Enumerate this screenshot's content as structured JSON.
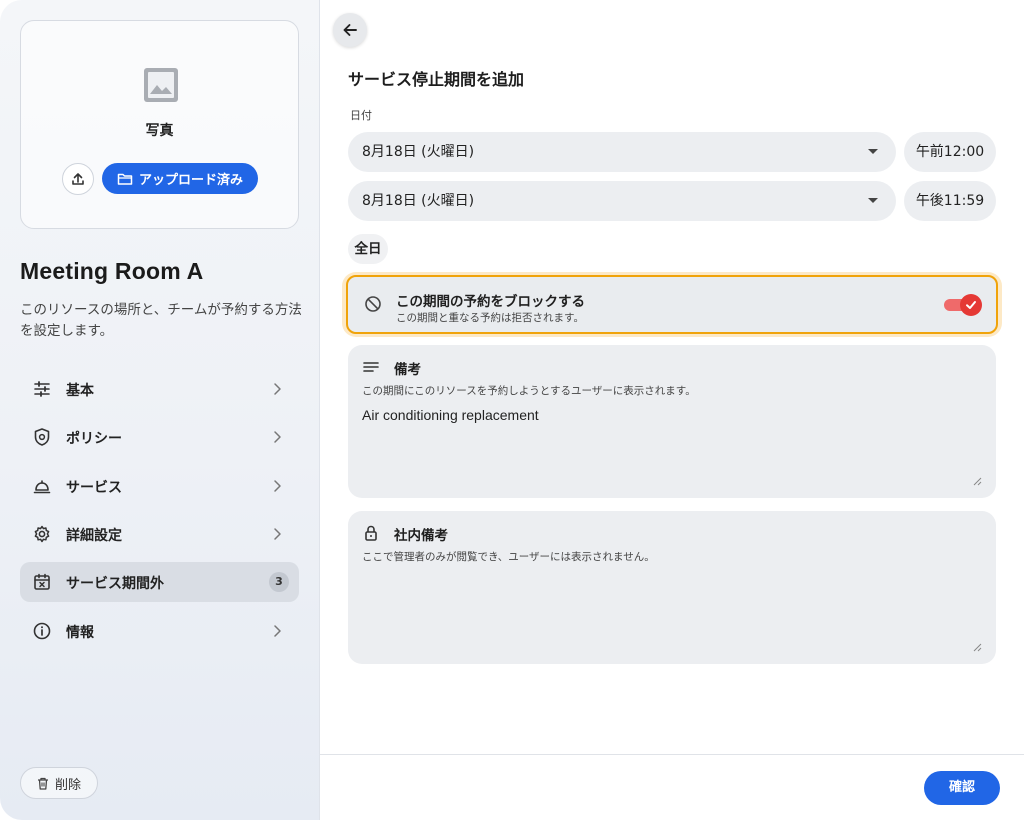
{
  "sidebar": {
    "photo_label": "写真",
    "uploaded_label": "アップロード済み",
    "room_title": "Meeting Room A",
    "room_description": "このリソースの場所と、チームが予約する方法を設定します。",
    "nav": [
      {
        "label": "基本",
        "icon": "sliders-icon"
      },
      {
        "label": "ポリシー",
        "icon": "shield-icon"
      },
      {
        "label": "サービス",
        "icon": "service-bell-icon"
      },
      {
        "label": "詳細設定",
        "icon": "gear-icon"
      },
      {
        "label": "サービス期間外",
        "icon": "calendar-x-icon",
        "badge": "3",
        "active": true
      },
      {
        "label": "情報",
        "icon": "info-icon"
      }
    ],
    "delete_label": "削除"
  },
  "main": {
    "title": "サービス停止期間を追加",
    "date_label": "日付",
    "start_date": "8月18日 (火曜日)",
    "start_time": "午前12:00",
    "end_date": "8月18日 (火曜日)",
    "end_time": "午後11:59",
    "all_day": "全日",
    "block": {
      "title": "この期間の予約をブロックする",
      "subtitle": "この期間と重なる予約は拒否されます。",
      "enabled": true
    },
    "note": {
      "title": "備考",
      "help": "この期間にこのリソースを予約しようとするユーザーに表示されます。",
      "value": "Air conditioning replacement"
    },
    "internal_note": {
      "title": "社内備考",
      "help": "ここで管理者のみが閲覧でき、ユーザーには表示されません。",
      "value": ""
    },
    "confirm_label": "確認"
  },
  "colors": {
    "accent": "#2166e6",
    "highlight_border": "#f0a30a",
    "toggle_on": "#e53935"
  }
}
